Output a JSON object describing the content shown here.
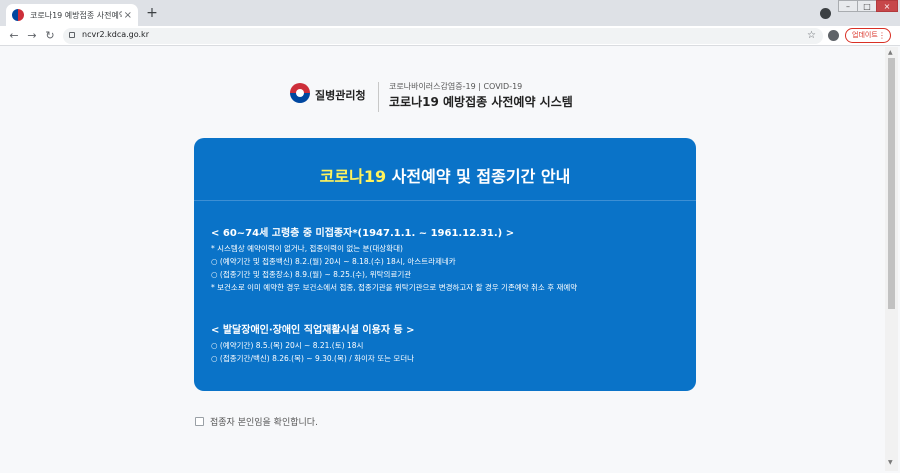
{
  "browser": {
    "tab_title": "코로나19 예방접종 사전예약 시스",
    "tab_close": "×",
    "new_tab": "+",
    "url": "ncvr2.kdca.go.kr",
    "update_label": "업데이트",
    "menu_dots": "⋮",
    "back": "←",
    "forward": "→",
    "reload": "↻",
    "bookmark": "☆",
    "window": {
      "minimize": "–",
      "maximize": "□",
      "close": "×"
    }
  },
  "header": {
    "agency": "질병관리청",
    "sub_label": "코로나바이러스감염증-19 | COVID-19",
    "system_title": "코로나19 예방접종 사전예약 시스템"
  },
  "notice": {
    "title_highlight": "코로나19",
    "title_rest": " 사전예약 및 접종기간 안내",
    "section1": {
      "heading": "< 60~74세 고령층 중 미접종자*(1947.1.1. ~ 1961.12.31.) >",
      "lines": [
        "* 시스템상 예약이력이 없거나, 접종이력이 없는 분(대상확대)",
        "○ (예약기간 및 접종백신) 8.2.(월) 20시 ~ 8.18.(수) 18시, 아스트라제네카",
        "○ (접종기간 및 접종장소) 8.9.(월) ~ 8.25.(수), 위탁의료기관",
        "* 보건소로 이미 예약한 경우 보건소에서 접종, 접종기관을 위탁기관으로 변경하고자 할 경우 기존예약 취소 후 재예약"
      ]
    },
    "section2": {
      "heading": "< 발달장애인·장애인 직업재활시설 이용자 등 >",
      "lines": [
        "○ (예약기간) 8.5.(목) 20시 ~ 8.21.(토) 18시",
        "○ (접종기간/백신) 8.26.(목) ~ 9.30.(목) / 화이자 또는 모더나"
      ]
    }
  },
  "confirm": {
    "label": "접종자 본인임을 확인합니다."
  },
  "colors": {
    "notice_bg": "#0a73c8",
    "highlight": "#fff35c",
    "update_red": "#d93025"
  }
}
